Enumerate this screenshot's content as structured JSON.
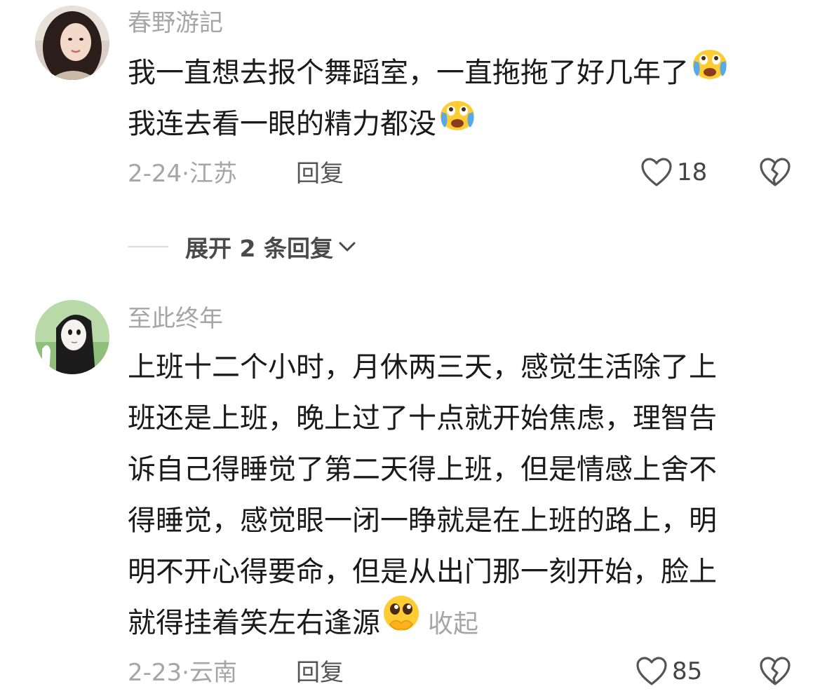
{
  "comments": [
    {
      "username": "春野游記",
      "lines": [
        "我一直想去报个舞蹈室，一直拖拖了好几年了",
        "我连去看一眼的精力都没"
      ],
      "date": "2-24",
      "separator": "·",
      "location": "江苏",
      "reply_label": "回复",
      "likes": "18",
      "avatar_icon": "avatar-girl-portrait",
      "emoji": "crying-face-emoji"
    },
    {
      "username": "至此终年",
      "lines": [
        "上班十二个小时，月休两三天，感觉生活除了上",
        "班还是上班，晚上过了十点就开始焦虑，理智告",
        "诉自己得睡觉了第二天得上班，但是情感上舍不",
        "得睡觉，感觉眼一闭一睁就是在上班的路上，明",
        "明不开心得要命，但是从出门那一刻开始，脸上",
        "就得挂着笑左右逢源"
      ],
      "collapse_label": "收起",
      "date": "2-23",
      "separator": "·",
      "location": "云南",
      "reply_label": "回复",
      "likes": "85",
      "avatar_icon": "avatar-anime-girl",
      "emoji": "pleading-face-emoji"
    }
  ],
  "expand_replies": {
    "label": "展开 2 条回复",
    "icon": "chevron-down-icon"
  },
  "colors": {
    "meta_gray": "#a6a6a6",
    "text": "#1a1a1a",
    "emoji_yellow": "#ffcc33",
    "tear_blue": "#5aa9e6"
  }
}
